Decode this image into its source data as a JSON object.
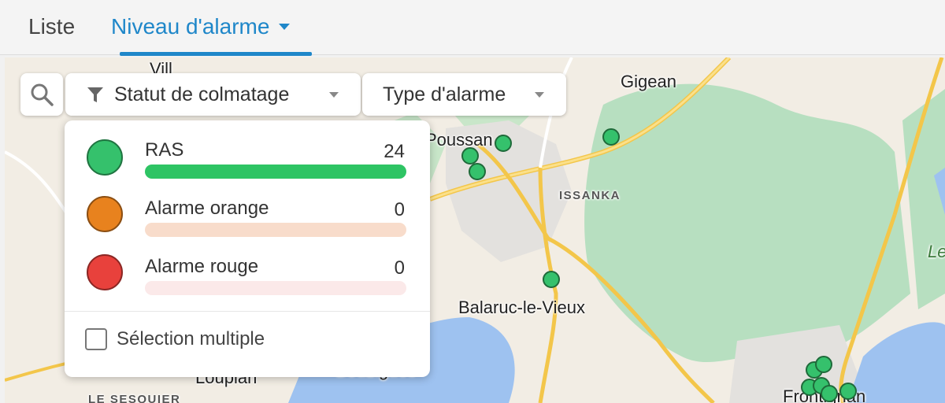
{
  "tabs": [
    {
      "label": "Liste",
      "active": false
    },
    {
      "label": "Niveau d'alarme",
      "active": true
    }
  ],
  "toolbar": {
    "search_icon": "search-icon",
    "statut_filter_label": "Statut de colmatage",
    "type_filter_label": "Type d'alarme"
  },
  "legend_panel": {
    "rows": [
      {
        "label": "RAS",
        "count": "24",
        "color": "#35c16c",
        "bar_color": "#2ec464",
        "fill_fraction": 1.0
      },
      {
        "label": "Alarme orange",
        "count": "0",
        "color": "#e8821e",
        "bar_color": "#f8dccb",
        "fill_fraction": 0.0
      },
      {
        "label": "Alarme rouge",
        "count": "0",
        "color": "#e8413c",
        "bar_color": "#fbe9e9",
        "fill_fraction": 0.0
      }
    ],
    "multi_select_label": "Sélection multiple",
    "multi_select_checked": false
  },
  "map": {
    "place_labels": [
      "Gigean",
      "Poussan",
      "ISSANKA",
      "Balaruc-le-Vieux",
      "Loupian",
      "Bouzigues",
      "LE SESQUIER",
      "Frontignan",
      "Le",
      "Vill"
    ]
  },
  "colors": {
    "accent": "#1f87c9",
    "marker": "#35c16c"
  }
}
